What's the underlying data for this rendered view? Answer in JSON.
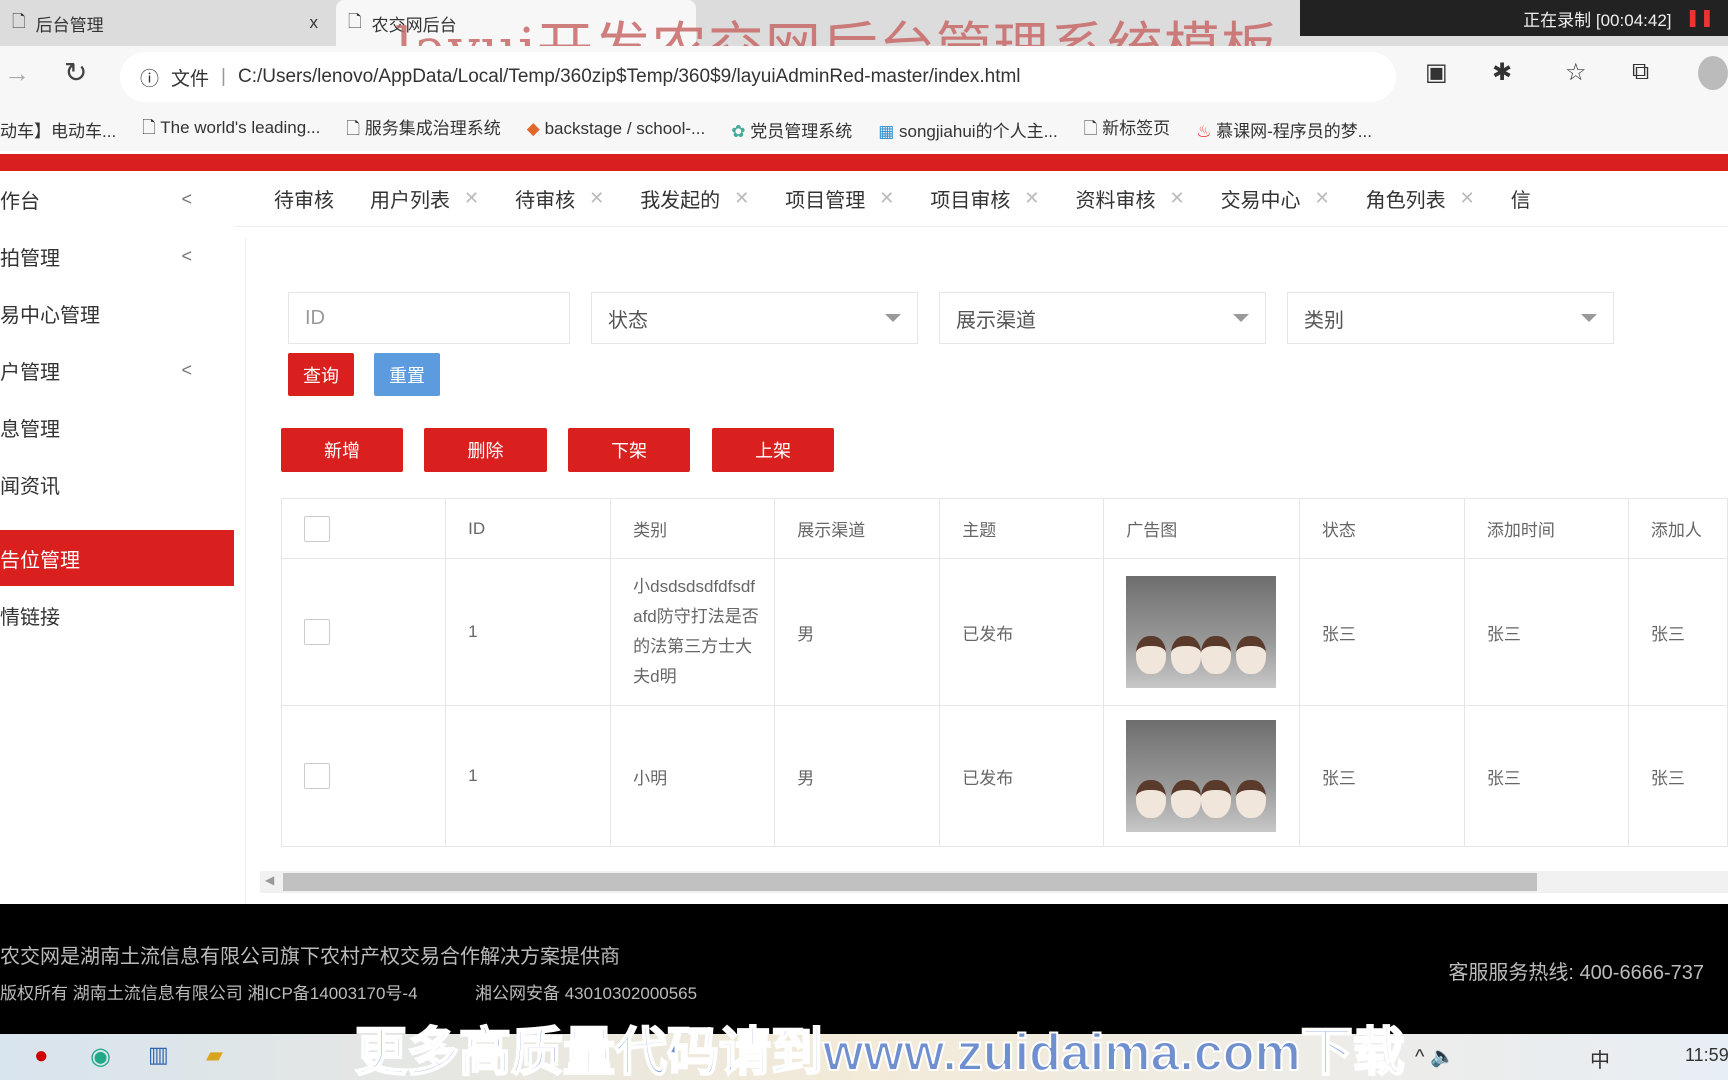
{
  "browser": {
    "tabs": [
      {
        "label": "后台管理",
        "close": "x"
      },
      {
        "label": "农交网后台"
      }
    ],
    "recording": "正在录制 [00:04:42]",
    "address_label": "文件",
    "url": "C:/Users/lenovo/AppData/Local/Temp/360zip$Temp/360$9/layuiAdminRed-master/index.html",
    "bookmarks": [
      "动车】电动车...",
      "The world's leading...",
      "服务集成治理系统",
      "backstage / school-...",
      "党员管理系统",
      "songjiahui的个人主...",
      "新标签页",
      "慕课网-程序员的梦..."
    ]
  },
  "watermark_top": "layui开发农交网后台管理系统模板",
  "watermark_bottom": "更多高质量代码请到www.zuidaima.com下载",
  "sidebar": {
    "items": [
      {
        "label": "作台",
        "chevron": true
      },
      {
        "label": "拍管理",
        "chevron": true
      },
      {
        "label": "易中心管理"
      },
      {
        "label": "户管理",
        "chevron": true
      },
      {
        "label": "息管理"
      },
      {
        "label": "闻资讯"
      },
      {
        "label": "告位管理",
        "active": true
      },
      {
        "label": "情链接"
      }
    ]
  },
  "page_tabs": [
    {
      "label": "待审核"
    },
    {
      "label": "用户列表"
    },
    {
      "label": "待审核"
    },
    {
      "label": "我发起的"
    },
    {
      "label": "项目管理"
    },
    {
      "label": "项目审核"
    },
    {
      "label": "资料审核"
    },
    {
      "label": "交易中心"
    },
    {
      "label": "角色列表"
    },
    {
      "label": "信"
    }
  ],
  "filters": {
    "id_placeholder": "ID",
    "status": "状态",
    "channel": "展示渠道",
    "category": "类别",
    "query": "查询",
    "reset": "重置"
  },
  "actions": {
    "add": "新增",
    "delete": "删除",
    "offline": "下架",
    "online": "上架"
  },
  "table": {
    "headers": [
      "ID",
      "类别",
      "展示渠道",
      "主题",
      "广告图",
      "状态",
      "添加时间",
      "添加人"
    ],
    "rows": [
      {
        "id": "1",
        "category": "小dsdsdsdfdfsdfafd防守打法是否的法第三方士大夫d明",
        "channel": "男",
        "theme": "已发布",
        "status": "张三",
        "time": "张三",
        "adder": "张三"
      },
      {
        "id": "1",
        "category": "小明",
        "channel": "男",
        "theme": "已发布",
        "status": "张三",
        "time": "张三",
        "adder": "张三"
      }
    ]
  },
  "footer": {
    "line1": "农交网是湖南土流信息有限公司旗下农村产权交易合作解决方案提供商",
    "line2": "版权所有 湖南土流信息有限公司 湘ICP备14003170号-4",
    "line3": "湘公网安备 43010302000565",
    "hotline": "客服服务热线: 400-6666-737"
  },
  "taskbar": {
    "ime": "中",
    "clock": "11:59"
  },
  "colors": {
    "accent": "#d9201f",
    "reset": "#5b9bde"
  }
}
